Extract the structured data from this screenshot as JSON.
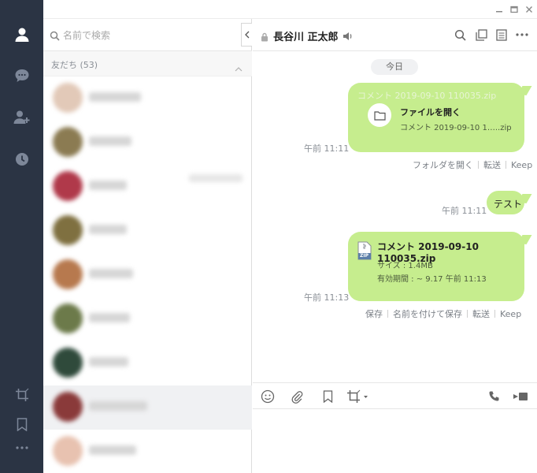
{
  "window": {
    "title": ""
  },
  "search": {
    "placeholder": "名前で検索"
  },
  "friends": {
    "section_label": "友だち (53)",
    "items": [
      {
        "name": "",
        "avatar_color": "#e2c9b8"
      },
      {
        "name": "",
        "avatar_color": "#8b7b52"
      },
      {
        "name": "",
        "avatar_color": "#b0394a"
      },
      {
        "name": "",
        "avatar_color": "#7f7040"
      },
      {
        "name": "",
        "avatar_color": "#b7794e"
      },
      {
        "name": "",
        "avatar_color": "#6c7a4a"
      },
      {
        "name": "",
        "avatar_color": "#2f4a3b"
      },
      {
        "name": "",
        "avatar_color": "#8a3a3a"
      },
      {
        "name": "",
        "avatar_color": "#e8c2b0"
      }
    ]
  },
  "chat": {
    "contact_name": "長谷川 正太郎",
    "date_label": "今日",
    "messages": [
      {
        "type": "file-open",
        "bg_text": "コメント 2019-09-10 110035.zip",
        "title": "ファイルを開く",
        "subtitle": "コメント 2019-09-10 1…..zip",
        "time": "午前 11:11",
        "actions": [
          "フォルダを開く",
          "転送",
          "Keep"
        ]
      },
      {
        "type": "text",
        "text": "テスト",
        "time": "午前 11:11"
      },
      {
        "type": "file",
        "file_name": "コメント 2019-09-10 110035.zip",
        "size": "サイズ : 1.4MB",
        "expiry": "有効期間 : ~ 9.17 午前 11:13",
        "icon_label": "ZIP",
        "time": "午前 11:13",
        "actions": [
          "保存",
          "名前を付けて保存",
          "転送",
          "Keep"
        ]
      }
    ]
  },
  "colors": {
    "rail": "#2b3444",
    "bubble": "#c6ed8e",
    "accent": "#7a7f86"
  }
}
